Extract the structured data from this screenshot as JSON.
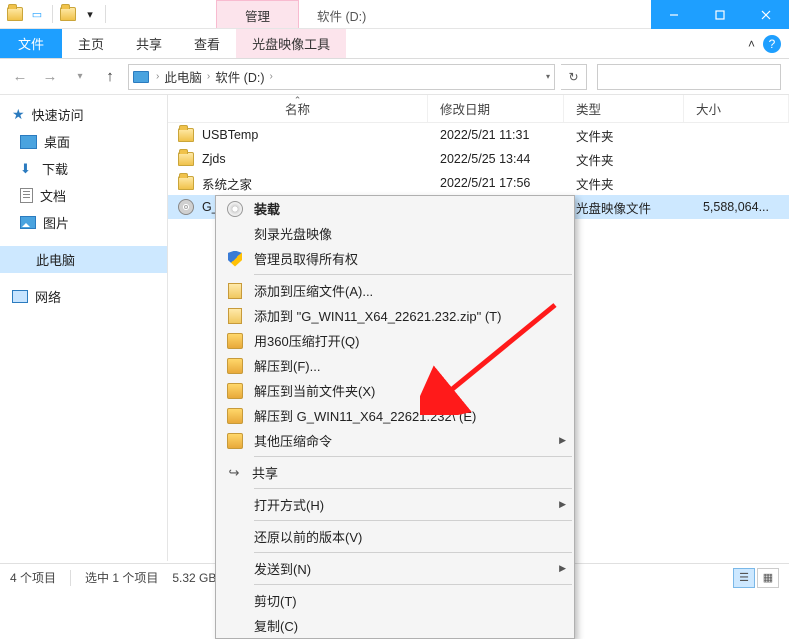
{
  "titlebar": {
    "contextual_tab": "管理",
    "window_title": "软件 (D:)"
  },
  "ribbon": {
    "file": "文件",
    "tabs": [
      "主页",
      "共享",
      "查看"
    ],
    "contextual": "光盘映像工具"
  },
  "breadcrumb": {
    "pc": "此电脑",
    "drive": "软件 (D:)"
  },
  "nav": {
    "quick_access": "快速访问",
    "desktop": "桌面",
    "downloads": "下载",
    "documents": "文档",
    "pictures": "图片",
    "this_pc": "此电脑",
    "network": "网络"
  },
  "columns": {
    "name": "名称",
    "date": "修改日期",
    "type": "类型",
    "size": "大小"
  },
  "files": [
    {
      "name": "USBTemp",
      "date": "2022/5/21 11:31",
      "type": "文件夹",
      "size": ""
    },
    {
      "name": "Zjds",
      "date": "2022/5/25 13:44",
      "type": "文件夹",
      "size": ""
    },
    {
      "name": "系统之家",
      "date": "2022/5/21 17:56",
      "type": "文件夹",
      "size": ""
    },
    {
      "name": "G_",
      "date": "",
      "type": "光盘映像文件",
      "size": "5,588,064..."
    }
  ],
  "context_menu": {
    "mount": "装载",
    "burn": "刻录光盘映像",
    "admin_own": "管理员取得所有权",
    "add_archive": "添加到压缩文件(A)...",
    "add_zip": "添加到 \"G_WIN11_X64_22621.232.zip\" (T)",
    "compress_360": "用360压缩打开(Q)",
    "extract_to": "解压到(F)...",
    "extract_here": "解压到当前文件夹(X)",
    "extract_named": "解压到 G_WIN11_X64_22621.232\\ (E)",
    "other_compress": "其他压缩命令",
    "share": "共享",
    "open_with": "打开方式(H)",
    "restore_prev": "还原以前的版本(V)",
    "send_to": "发送到(N)",
    "cut": "剪切(T)",
    "copy": "复制(C)"
  },
  "status": {
    "count": "4 个项目",
    "selected": "选中 1 个项目",
    "size": "5.32 GB"
  }
}
